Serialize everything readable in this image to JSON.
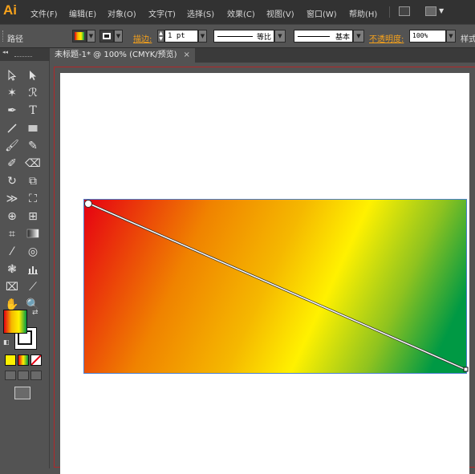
{
  "app": {
    "logo": "Ai"
  },
  "menu": [
    {
      "label": "文件(F)"
    },
    {
      "label": "编辑(E)"
    },
    {
      "label": "对象(O)"
    },
    {
      "label": "文字(T)"
    },
    {
      "label": "选择(S)"
    },
    {
      "label": "效果(C)"
    },
    {
      "label": "视图(V)"
    },
    {
      "label": "窗口(W)"
    },
    {
      "label": "帮助(H)"
    }
  ],
  "control": {
    "selection_type": "路径",
    "stroke_label": "描边:",
    "stroke_weight": "1 pt",
    "profile_label": "等比",
    "brush_label": "基本",
    "opacity_label": "不透明度:",
    "opacity_value": "100%",
    "style_label": "样式"
  },
  "document": {
    "tab_title": "未标题-1* @ 100% (CMYK/预览)",
    "tab_close": "×"
  },
  "artwork": {
    "type": "linear-gradient rectangle",
    "gradient_stops": [
      "#e60012",
      "#f08300",
      "#fff100",
      "#8fc31f",
      "#009944"
    ]
  },
  "colors": {
    "fill_swatch": "gradient",
    "stroke_swatch": "#000000",
    "selection_accent": "#4a7fd0",
    "artboard_border": "#b0282a"
  },
  "tools": [
    "selection-tool",
    "direct-selection-tool",
    "magic-wand-tool",
    "lasso-tool",
    "pen-tool",
    "type-tool",
    "line-tool",
    "rectangle-tool",
    "paintbrush-tool",
    "pencil-tool",
    "blob-brush-tool",
    "eraser-tool",
    "rotate-tool",
    "scale-tool",
    "width-tool",
    "free-transform-tool",
    "shape-builder-tool",
    "perspective-grid-tool",
    "mesh-tool",
    "gradient-tool",
    "eyedropper-tool",
    "blend-tool",
    "symbol-sprayer-tool",
    "column-graph-tool",
    "artboard-tool",
    "slice-tool",
    "hand-tool",
    "zoom-tool"
  ]
}
